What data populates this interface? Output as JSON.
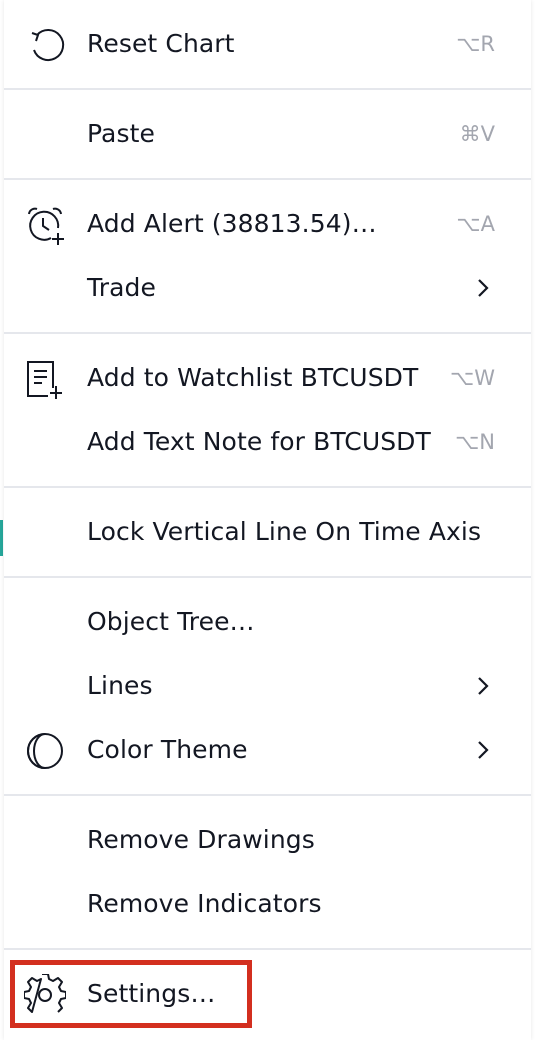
{
  "menu": {
    "items": [
      {
        "label": "Reset Chart",
        "shortcut": "⌥R",
        "icon": "reset-icon"
      },
      {
        "label": "Paste",
        "shortcut": "⌘V"
      },
      {
        "label": "Add Alert (38813.54)…",
        "shortcut": "⌥A",
        "icon": "alarm-clock-plus-icon"
      },
      {
        "label": "Trade",
        "submenu": true
      },
      {
        "label": "Add to Watchlist BTCUSDT",
        "shortcut": "⌥W",
        "icon": "watchlist-add-icon"
      },
      {
        "label": "Add Text Note for BTCUSDT",
        "shortcut": "⌥N"
      },
      {
        "label": "Lock Vertical Line On Time Axis"
      },
      {
        "label": "Object Tree…"
      },
      {
        "label": "Lines",
        "submenu": true
      },
      {
        "label": "Color Theme",
        "submenu": true,
        "icon": "moon-icon"
      },
      {
        "label": "Remove Drawings"
      },
      {
        "label": "Remove Indicators"
      },
      {
        "label": "Settings…",
        "icon": "gear-icon"
      }
    ]
  },
  "colors": {
    "text": "#131722",
    "shortcut": "#a3a6af",
    "separator": "#e5e7ec",
    "highlight_border": "#d32f1f"
  }
}
